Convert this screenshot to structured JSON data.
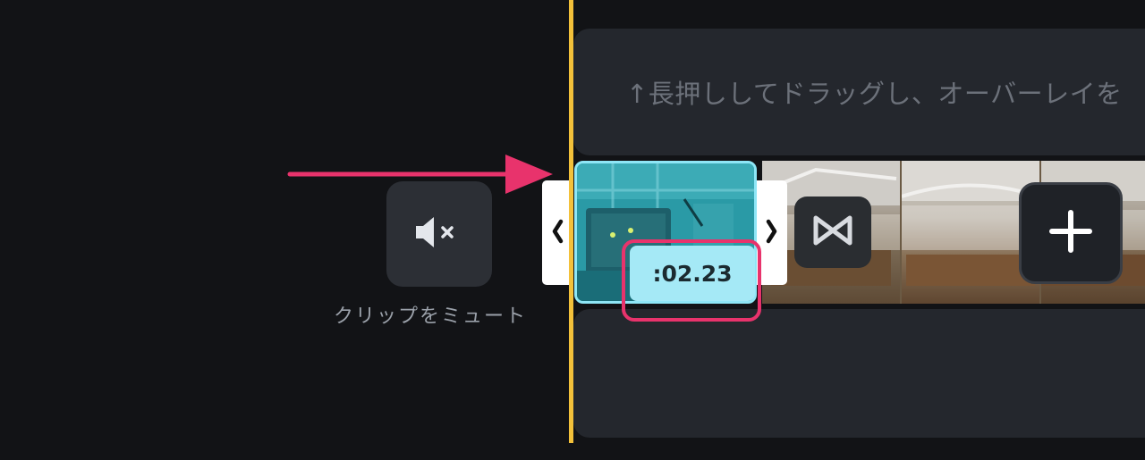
{
  "timeline": {
    "overlay_hint": "↑長押ししてドラッグし、オーバーレイを",
    "mute_label": "クリップをミュート",
    "clip_duration": ":02.23",
    "icons": {
      "mute": "speaker-mute-icon",
      "trim_left": "chevron-left-icon",
      "trim_right": "chevron-right-icon",
      "transition": "transition-icon",
      "add": "plus-icon"
    }
  },
  "colors": {
    "playhead": "#f3c13a",
    "annotation": "#e8336c",
    "selection": "#8ee6f6"
  }
}
